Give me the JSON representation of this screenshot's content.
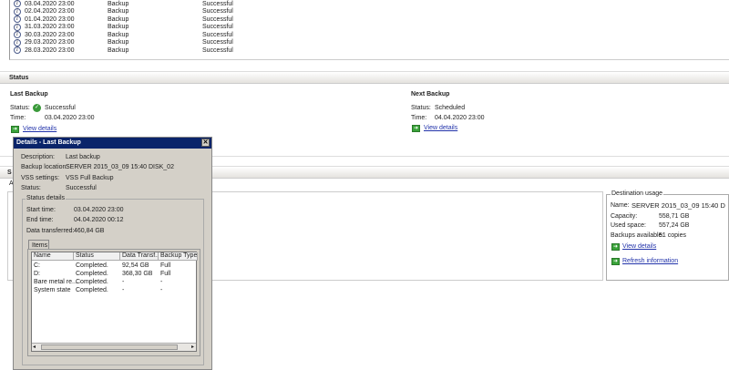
{
  "history": [
    {
      "time": "03.04.2020 23:00",
      "type": "Backup",
      "result": "Successful"
    },
    {
      "time": "02.04.2020 23:00",
      "type": "Backup",
      "result": "Successful"
    },
    {
      "time": "01.04.2020 23:00",
      "type": "Backup",
      "result": "Successful"
    },
    {
      "time": "31.03.2020 23:00",
      "type": "Backup",
      "result": "Successful"
    },
    {
      "time": "30.03.2020 23:00",
      "type": "Backup",
      "result": "Successful"
    },
    {
      "time": "29.03.2020 23:00",
      "type": "Backup",
      "result": "Successful"
    },
    {
      "time": "28.03.2020 23:00",
      "type": "Backup",
      "result": "Successful"
    }
  ],
  "status": {
    "header": "Status",
    "last": {
      "title": "Last Backup",
      "status_label": "Status:",
      "status": "Successful",
      "time_label": "Time:",
      "time": "03.04.2020 23:00",
      "link": "View details"
    },
    "next": {
      "title": "Next Backup",
      "status_label": "Status:",
      "status": "Scheduled",
      "time_label": "Time:",
      "time": "04.04.2020 23:00",
      "link": "View details"
    }
  },
  "section2": {
    "header_partial": "S",
    "sub_partial": "A"
  },
  "destination": {
    "legend": "Destination usage",
    "name_label": "Name:",
    "name": "SERVER 2015_03_09 15:40 D",
    "capacity_label": "Capacity:",
    "capacity": "558,71 GB",
    "used_label": "Used space:",
    "used": "557,24 GB",
    "avail_label": "Backups available:",
    "avail": "51 copies",
    "view_link": "View details",
    "refresh_link": "Refresh information"
  },
  "dialog": {
    "title": "Details - Last Backup",
    "desc_label": "Description:",
    "desc": "Last backup",
    "loc_label": "Backup location:",
    "loc": "SERVER 2015_03_09 15:40 DISK_02",
    "vss_label": "VSS settings:",
    "vss": "VSS Full Backup",
    "status_label": "Status:",
    "status": "Successful",
    "group": "Status details",
    "start_label": "Start time:",
    "start": "03.04.2020 23:00",
    "end_label": "End time:",
    "end": "04.04.2020 00:12",
    "data_label": "Data transferred:",
    "data": "460,84 GB",
    "tab": "Items",
    "columns": [
      "Name",
      "Status",
      "Data Transf...",
      "Backup Type"
    ],
    "rows": [
      [
        "C:",
        "Completed.",
        "92,54 GB",
        "Full"
      ],
      [
        "D:",
        "Completed.",
        "368,30 GB",
        "Full"
      ],
      [
        "Bare metal re...",
        "Completed.",
        "-",
        "-"
      ],
      [
        "System state",
        "Completed.",
        "-",
        "-"
      ]
    ]
  }
}
